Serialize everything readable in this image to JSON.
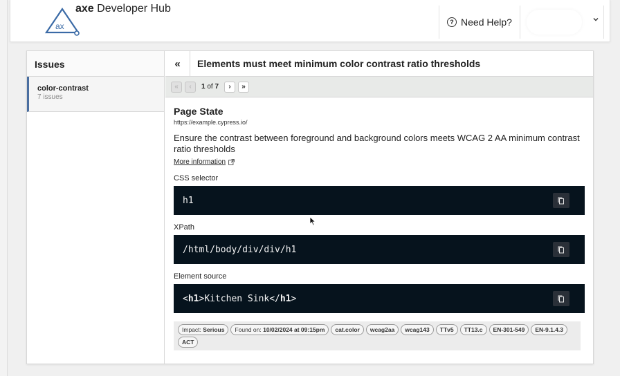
{
  "header": {
    "brand": "axe",
    "product": "Developer Hub",
    "help_label": "Need Help?"
  },
  "sidebar": {
    "heading": "Issues",
    "items": [
      {
        "name": "color-contrast",
        "count": "7 issues"
      }
    ]
  },
  "issue": {
    "title": "Elements must meet minimum color contrast ratio thresholds",
    "pager": {
      "current": "1",
      "of": "of",
      "total": "7"
    },
    "page_state_title": "Page State",
    "url": "https://example.cypress.io/",
    "description": "Ensure the contrast between foreground and background colors meets WCAG 2 AA minimum contrast ratio thresholds",
    "more_info": "More information",
    "css_selector_label": "CSS selector",
    "css_selector": "h1",
    "xpath_label": "XPath",
    "xpath": "/html/body/div/div/h1",
    "element_source_label": "Element source",
    "element_source": {
      "open": "<",
      "tag": "h1",
      "close": ">",
      "text": "Kitchen Sink",
      "end_open": "</",
      "end_tag": "h1",
      "end_close": ">"
    },
    "tags": [
      {
        "label": "Impact:",
        "value": "Serious"
      },
      {
        "label": "Found on:",
        "value": "10/02/2024 at 09:15pm"
      },
      {
        "label": "",
        "value": "cat.color"
      },
      {
        "label": "",
        "value": "wcag2aa"
      },
      {
        "label": "",
        "value": "wcag143"
      },
      {
        "label": "",
        "value": "TTv5"
      },
      {
        "label": "",
        "value": "TT13.c"
      },
      {
        "label": "",
        "value": "EN-301-549"
      },
      {
        "label": "",
        "value": "EN-9.1.4.3"
      },
      {
        "label": "",
        "value": "ACT"
      }
    ]
  },
  "colors": {
    "code_bg": "#06131d",
    "accent": "#4a6ea0"
  },
  "icons": [
    "ax-logo-icon",
    "help-circle-icon",
    "chevron-down-icon",
    "collapse-icon",
    "first-page-icon",
    "prev-page-icon",
    "next-page-icon",
    "last-page-icon",
    "external-link-icon",
    "copy-icon",
    "mouse-cursor-icon"
  ]
}
